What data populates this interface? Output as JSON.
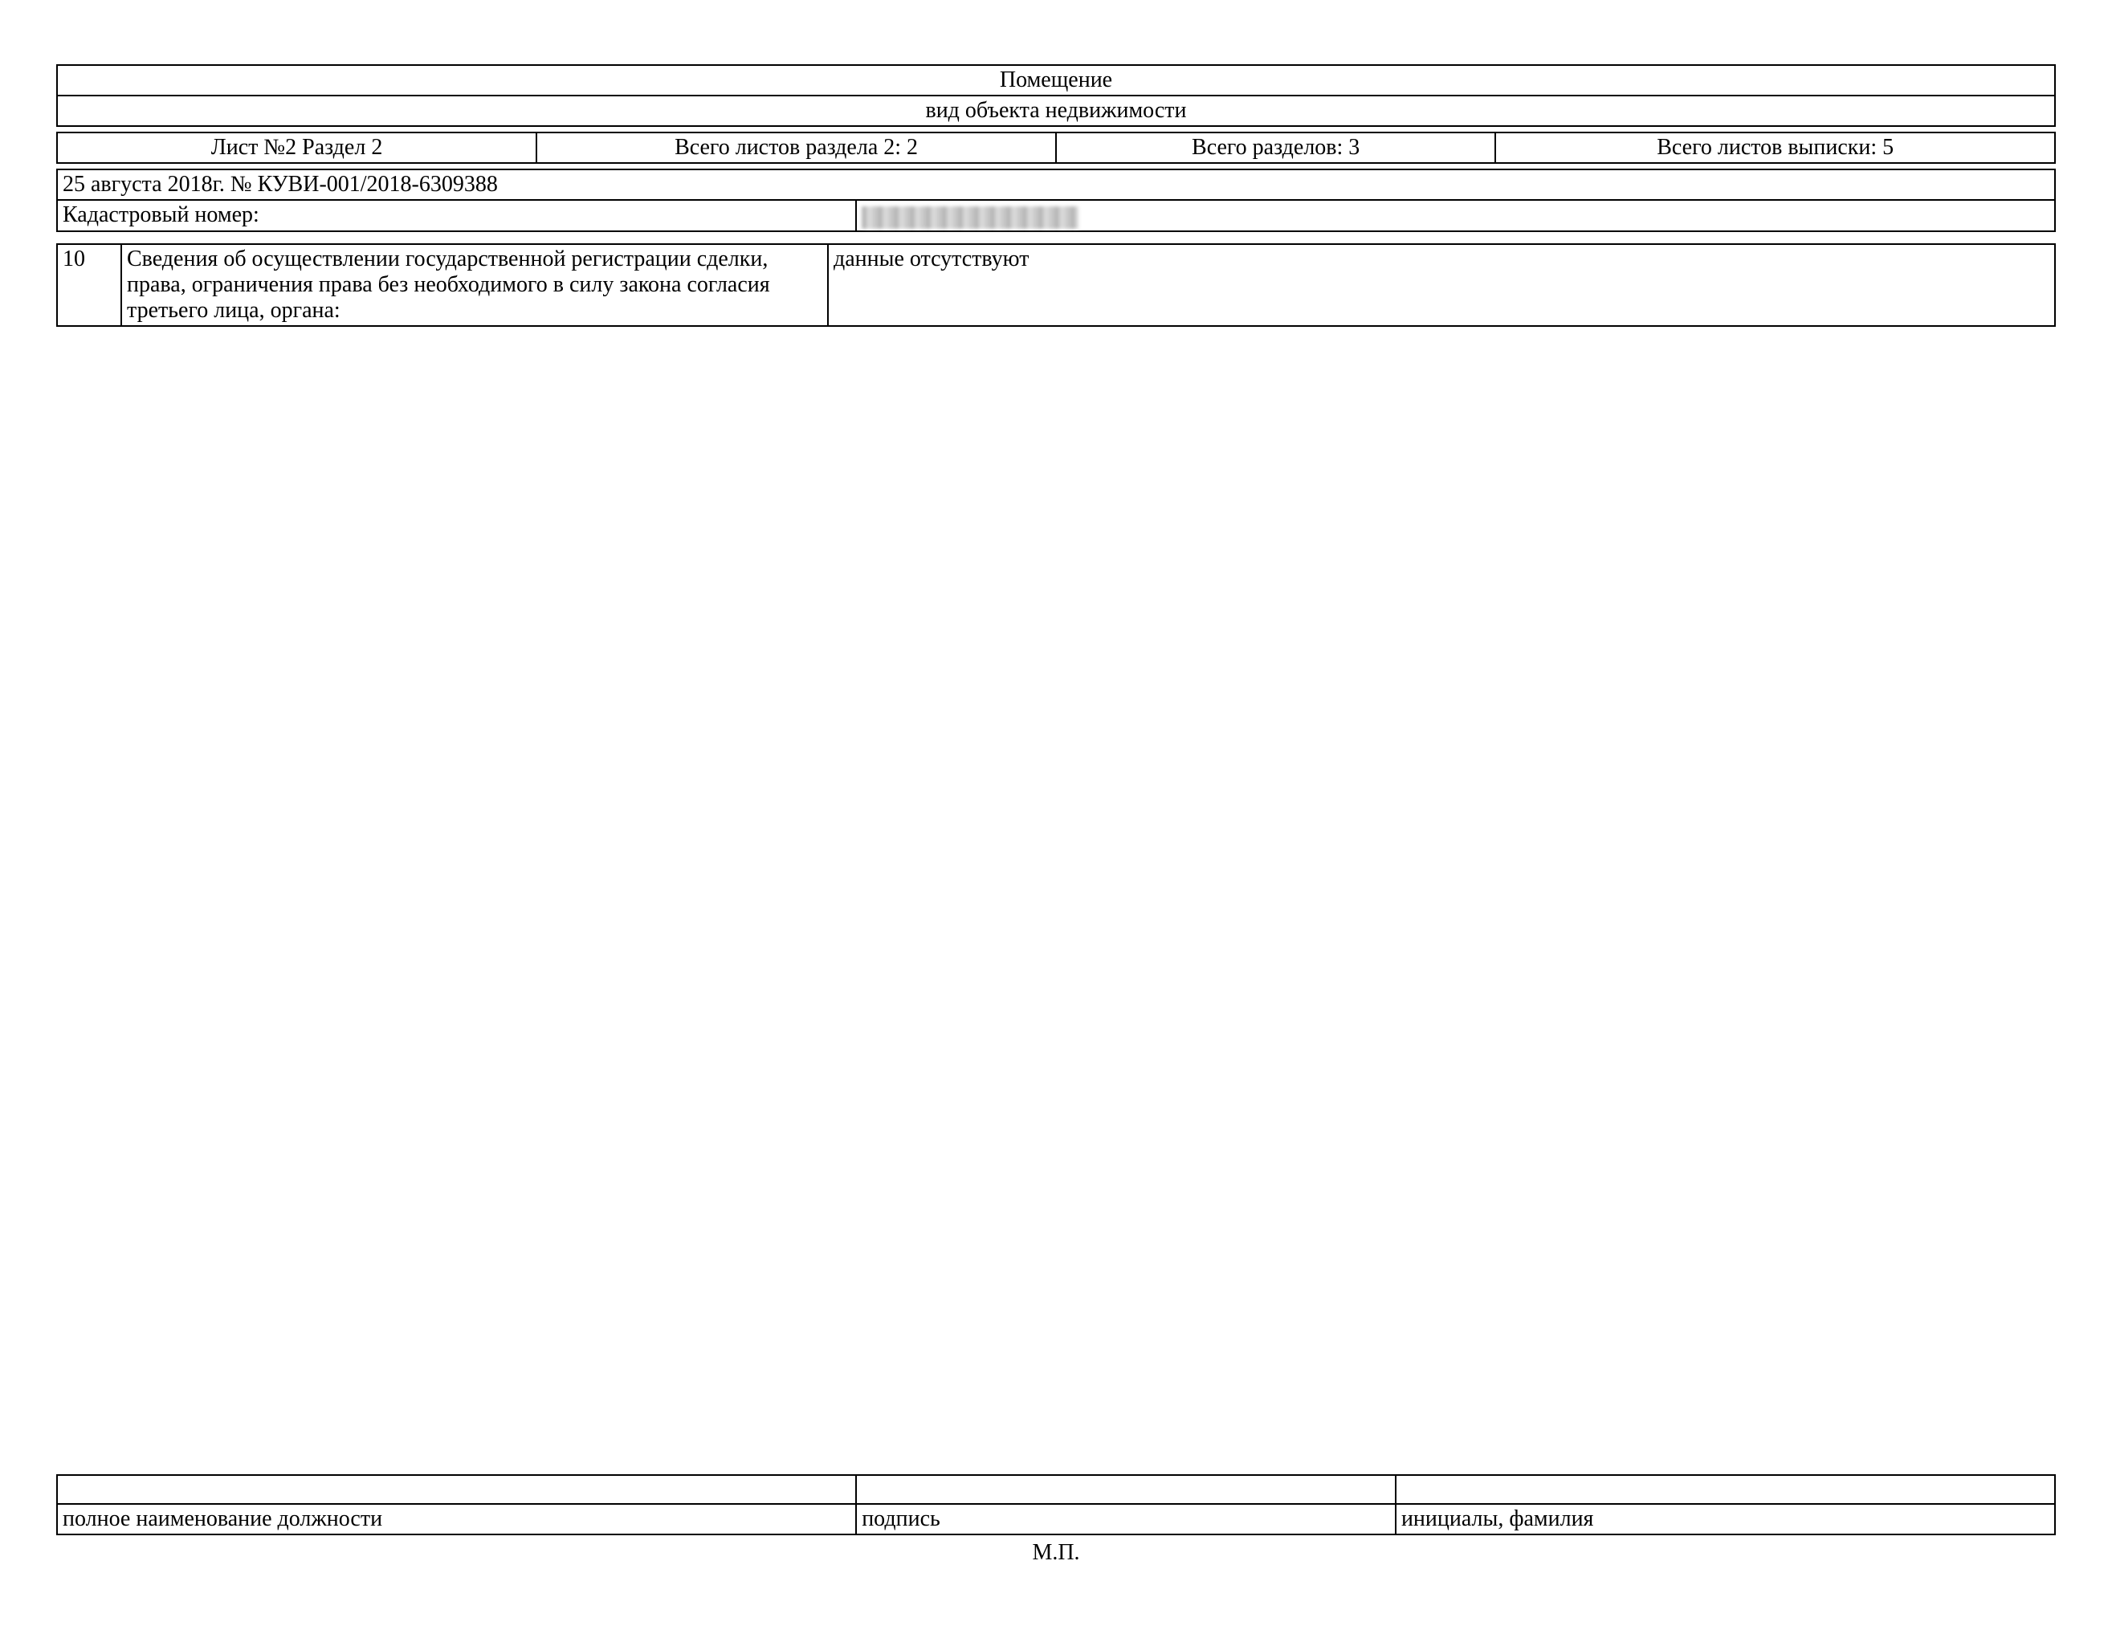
{
  "header": {
    "title": "Помещение",
    "subtitle": "вид объекта недвижимости"
  },
  "counts": {
    "sheet_section": "Лист №2  Раздел 2",
    "total_section_sheets": "Всего листов раздела 2: 2",
    "total_sections": "Всего разделов: 3",
    "total_extract_sheets": "Всего листов выписки: 5"
  },
  "meta": {
    "date_doc": "25 августа 2018г. № КУВИ-001/2018-6309388",
    "cadastral_label": "Кадастровый номер:"
  },
  "row10": {
    "num": "10",
    "label": "Сведения об осуществлении государственной регистрации сделки, права, ограничения права без необходимого в силу закона согласия третьего лица, органа:",
    "value": "данные отсутствуют"
  },
  "footer": {
    "col1": "полное наименование должности",
    "col2": "подпись",
    "col3": "инициалы, фамилия",
    "mp": "М.П."
  }
}
